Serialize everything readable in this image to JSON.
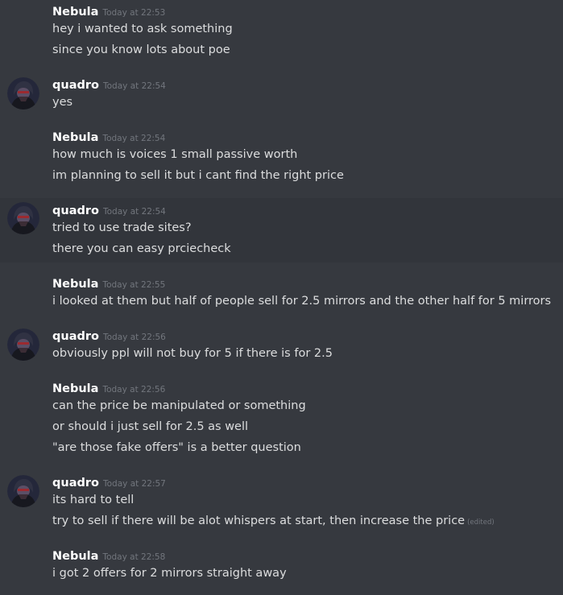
{
  "messages": [
    {
      "author": "Nebula",
      "timestamp": "Today at 22:53",
      "avatar": null,
      "lines": [
        "hey i wanted to ask something",
        "since you know lots about poe"
      ]
    },
    {
      "author": "quadro",
      "timestamp": "Today at 22:54",
      "avatar": "hooded-figure-avatar",
      "lines": [
        "yes"
      ]
    },
    {
      "author": "Nebula",
      "timestamp": "Today at 22:54",
      "avatar": null,
      "lines": [
        "how much is voices 1 small passive worth",
        "im planning to sell it but i cant find the right price"
      ]
    },
    {
      "author": "quadro",
      "timestamp": "Today at 22:54",
      "avatar": "hooded-figure-avatar",
      "lines": [
        "tried to use trade sites?",
        "there you can easy prciecheck"
      ]
    },
    {
      "author": "Nebula",
      "timestamp": "Today at 22:55",
      "avatar": null,
      "lines": [
        "i looked at them but half of people sell for 2.5 mirrors and the other half for 5 mirrors"
      ]
    },
    {
      "author": "quadro",
      "timestamp": "Today at 22:56",
      "avatar": "hooded-figure-avatar",
      "lines": [
        "obviously ppl will not buy for 5 if there is for 2.5"
      ]
    },
    {
      "author": "Nebula",
      "timestamp": "Today at 22:56",
      "avatar": null,
      "lines": [
        "can the price be manipulated or something",
        "or should i just sell for 2.5 as well",
        "\"are those fake offers\" is a better question"
      ]
    },
    {
      "author": "quadro",
      "timestamp": "Today at 22:57",
      "avatar": "hooded-figure-avatar",
      "lines": [
        "its hard to tell",
        "try to sell if there will be alot whispers at start, then increase the price"
      ],
      "edited_label": "(edited)"
    },
    {
      "author": "Nebula",
      "timestamp": "Today at 22:58",
      "avatar": null,
      "lines": [
        "i got 2 offers for 2 mirrors straight away"
      ]
    }
  ],
  "colors": {
    "background": "#36393f",
    "hover_background": "#32353b",
    "username": "#ffffff",
    "message_text": "#dcddde",
    "timestamp": "#72767d"
  }
}
